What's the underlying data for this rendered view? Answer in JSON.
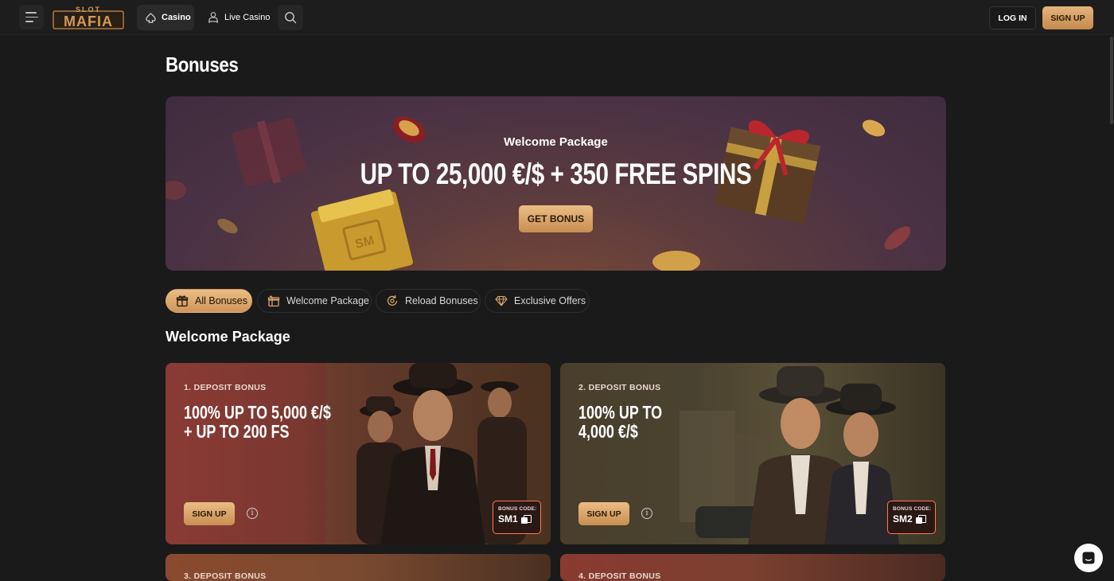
{
  "header": {
    "logo_text": "SLOT MAFIA",
    "nav": [
      {
        "label": "Casino",
        "icon": "spade-icon",
        "active": true
      },
      {
        "label": "Live Casino",
        "icon": "dealer-icon",
        "active": false
      }
    ],
    "login_label": "LOG IN",
    "signup_label": "SIGN UP"
  },
  "page": {
    "title": "Bonuses"
  },
  "hero": {
    "subtitle": "Welcome Package",
    "title": "UP TO 25,000 €/$ + 350 FREE SPINS",
    "button_label": "GET BONUS"
  },
  "filters": [
    {
      "label": "All Bonuses",
      "icon": "gift-icon",
      "active": true
    },
    {
      "label": "Welcome Package",
      "icon": "gift-box-icon",
      "active": false
    },
    {
      "label": "Reload Bonuses",
      "icon": "reload-icon",
      "active": false
    },
    {
      "label": "Exclusive Offers",
      "icon": "diamond-icon",
      "active": false
    }
  ],
  "section": {
    "title": "Welcome Package"
  },
  "cards": [
    {
      "label": "1. DEPOSIT BONUS",
      "title": "100% UP TO 5,000 €/$\n+ UP TO 200 FS",
      "button_label": "SIGN UP",
      "code_label": "BONUS CODE:",
      "code": "SM1"
    },
    {
      "label": "2. DEPOSIT BONUS",
      "title": "100% UP TO\n4,000 €/$",
      "button_label": "SIGN UP",
      "code_label": "BONUS CODE:",
      "code": "SM2"
    },
    {
      "label": "3. DEPOSIT BONUS"
    },
    {
      "label": "4. DEPOSIT BONUS"
    }
  ],
  "colors": {
    "accent": "#d9a46a",
    "code_border": "#ff7a55",
    "background": "#1a1a1a"
  }
}
